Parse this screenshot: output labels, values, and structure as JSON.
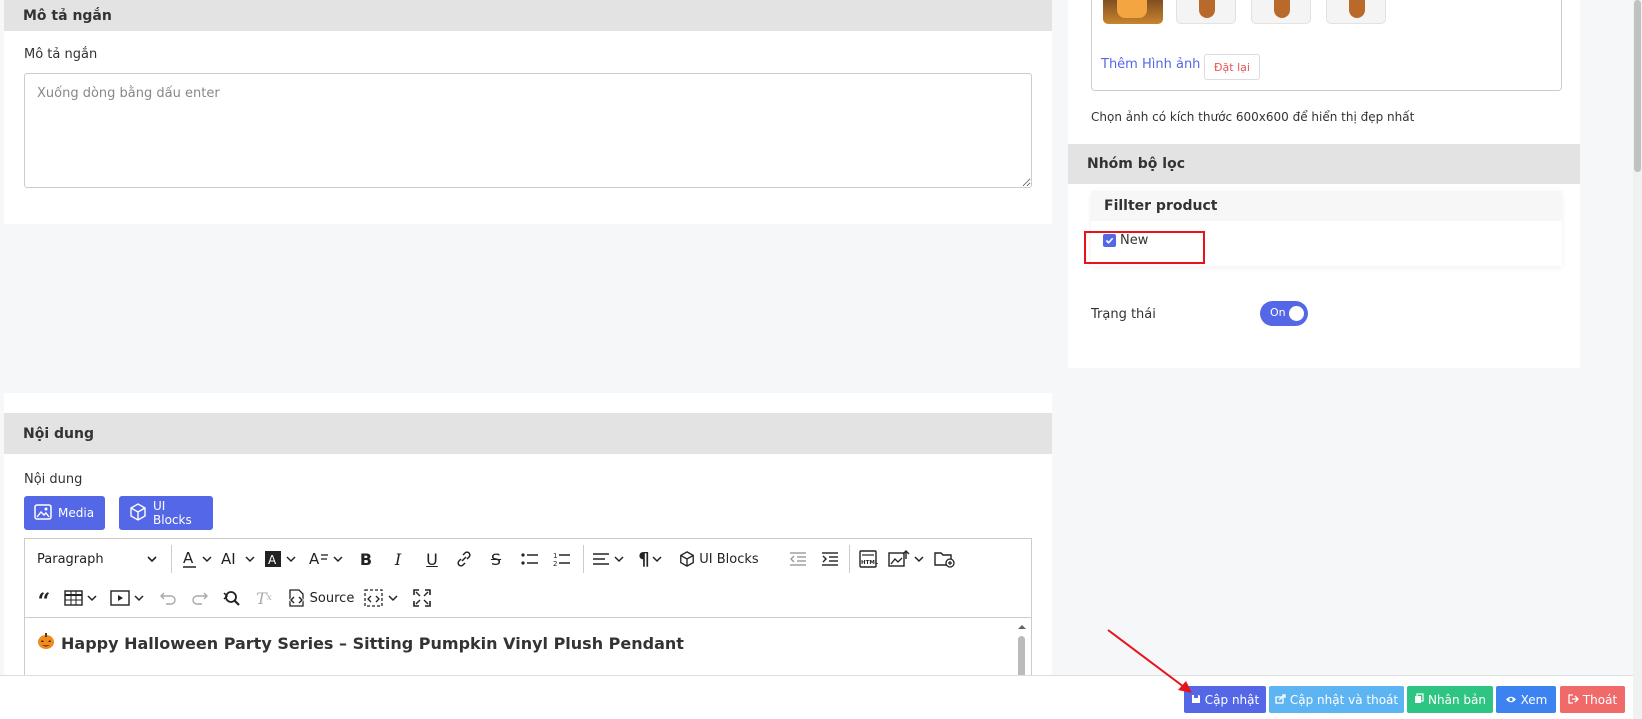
{
  "short_desc": {
    "header": "Mô tả ngắn",
    "label": "Mô tả ngắn",
    "placeholder": "Xuống dòng bằng dấu enter"
  },
  "content": {
    "header": "Nội dung",
    "label": "Nội dung",
    "media_button": "Media",
    "uiblocks_button": "UI Blocks",
    "toolbar": {
      "paragraph_select": "Paragraph",
      "uiblocks_label": "UI Blocks",
      "source_label": "Source"
    },
    "editor_heading": "Happy Halloween Party Series – Sitting Pumpkin Vinyl Plush Pendant"
  },
  "images": {
    "add_link": "Thêm Hình ảnh",
    "reset_button": "Đặt lại",
    "hint": "Chọn ảnh có kích thước 600x600 để hiển thị đẹp nhất"
  },
  "filter": {
    "header": "Nhóm bộ lọc",
    "group_title": "Fillter product",
    "option_label": "New",
    "option_checked": true
  },
  "status": {
    "label": "Trạng thái",
    "toggle_text": "On"
  },
  "actions": {
    "update": "Cập nhật",
    "update_exit": "Cập nhật và thoát",
    "duplicate": "Nhân bản",
    "view": "Xem",
    "exit": "Thoát"
  },
  "colors": {
    "primary": "#5468e7",
    "update_exit": "#5cb4f3",
    "duplicate": "#2ec481",
    "view": "#3c82f0",
    "exit": "#f06a6a",
    "highlight": "#e8121a"
  }
}
